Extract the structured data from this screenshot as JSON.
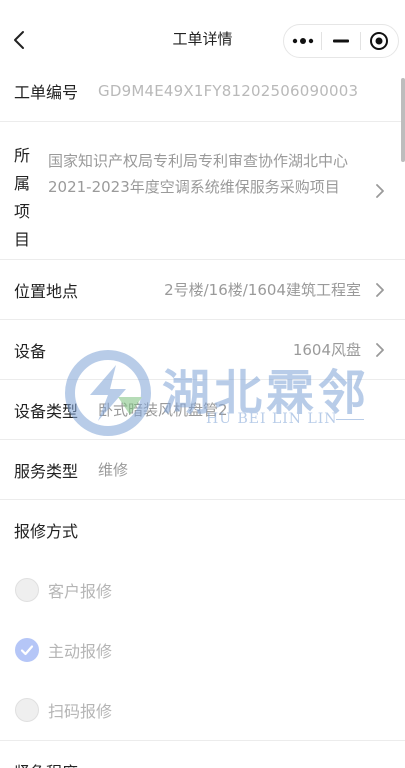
{
  "nav": {
    "title": "工单详情",
    "icons": [
      "back-icon",
      "more-icon",
      "minimize-icon",
      "close-target-icon"
    ]
  },
  "fields": {
    "work_order": {
      "label": "工单编号",
      "value": "GD9M4E49X1FY81202506090003"
    },
    "project": {
      "label_chars": [
        "所",
        "属",
        "项",
        "目"
      ],
      "value": "国家知识产权局专利局专利审查协作湖北中心2021-2023年度空调系统维保服务采购项目"
    },
    "location": {
      "label": "位置地点",
      "value": "2号楼/16楼/1604建筑工程室"
    },
    "device": {
      "label": "设备",
      "value": "1604风盘"
    },
    "device_type": {
      "label": "设备类型",
      "value": "卧式暗装风机盘管2"
    },
    "service_type": {
      "label": "服务类型",
      "value": "维修"
    },
    "repair_method": {
      "label": "报修方式",
      "options": [
        {
          "label": "客户报修",
          "checked": false
        },
        {
          "label": "主动报修",
          "checked": true
        },
        {
          "label": "扫码报修",
          "checked": false
        }
      ]
    },
    "urgency": {
      "label": "紧急程度"
    }
  },
  "watermark": {
    "text": "湖北霖邻",
    "sub": "HU BEI LIN LIN"
  },
  "colors": {
    "accent": "#b5c6f7",
    "value_gray": "#9a9a9a",
    "divider": "#ececec"
  }
}
